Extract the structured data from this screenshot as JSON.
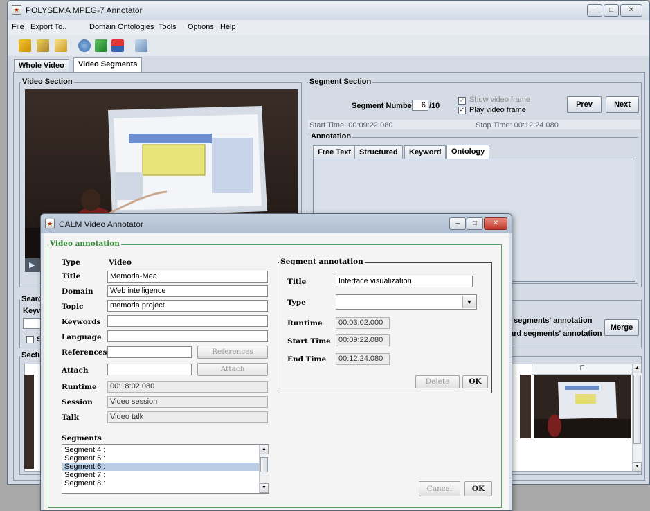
{
  "main_window": {
    "title": "POLYSEMA MPEG-7 Annotator",
    "controls": {
      "minimize": "‒",
      "maximize": "□",
      "close": "✕"
    }
  },
  "menubar": {
    "items": [
      "File",
      "Export To..",
      "Domain Ontologies",
      "Tools",
      "Options",
      "Help"
    ]
  },
  "toolbar": {
    "icons": [
      "open-icon",
      "save-icon",
      "export-icon",
      "refresh-icon",
      "add-icon",
      "flag-icon",
      "edit-icon"
    ]
  },
  "tabs": {
    "whole_video": "Whole Video",
    "video_segments": "Video Segments"
  },
  "video_section": {
    "label": "Video Section"
  },
  "segment_section": {
    "label": "Segment Section",
    "segment_number_label": "Segment Number:",
    "segment_number_value": "6",
    "segment_total": "/10",
    "show_video_frame": "Show video frame",
    "play_video_frame": "Play video frame",
    "prev": "Prev",
    "next": "Next",
    "start_time": "Start Time: 00:09:22.080",
    "stop_time": "Stop Time: 00:12:24.080"
  },
  "annotation": {
    "label": "Annotation",
    "tabs": [
      "Free Text",
      "Structured",
      "Keyword",
      "Ontology"
    ]
  },
  "search_partial": {
    "label": "Searc",
    "keyword_label": "Keyw",
    "checkbox_label": "Se"
  },
  "merge_section": {
    "merge_option": "rge segments' annotation",
    "discard_option": "card segments' annotation",
    "merge_button": "Merge"
  },
  "sections_partial": {
    "label": "Sectio",
    "column_f": "F"
  },
  "dialog": {
    "title": "CALM Video Annotator",
    "controls": {
      "minimize": "‒",
      "maximize": "□",
      "close": "✕"
    },
    "video_annotation": {
      "label": "Video annotation",
      "type_label": "Type",
      "type_value": "Video",
      "title_label": "Title",
      "title_value": "Memoria-Mea",
      "domain_label": "Domain",
      "domain_value": "Web intelligence",
      "topic_label": "Topic",
      "topic_value": "memoria project",
      "keywords_label": "Keywords",
      "keywords_value": "",
      "language_label": "Language",
      "language_value": "",
      "references_label": "References",
      "references_value": "",
      "references_button": "References",
      "attach_label": "Attach",
      "attach_value": "",
      "attach_button": "Attach",
      "runtime_label": "Runtime",
      "runtime_value": "00:18:02.080",
      "session_label": "Session",
      "session_value": "Video session",
      "talk_label": "Talk",
      "talk_value": "Video talk",
      "segments_label": "Segments",
      "segments": [
        "Segment 4 :",
        "Segment 5 :",
        "Segment 6 :",
        "Segment 7 :",
        "Segment 8 :"
      ],
      "selected_segment": "Segment 6 :"
    },
    "segment_annotation": {
      "label": "Segment annotation",
      "title_label": "Title",
      "title_value": "Interface visualization",
      "type_label": "Type",
      "type_value": "",
      "runtime_label": "Runtime",
      "runtime_value": "00:03:02.000",
      "start_label": "Start Time",
      "start_value": "00:09:22.080",
      "end_label": "End Time",
      "end_value": "00:12:24.080",
      "delete_button": "Delete",
      "ok_button": "OK"
    },
    "cancel_button": "Cancel",
    "ok_button": "OK"
  }
}
